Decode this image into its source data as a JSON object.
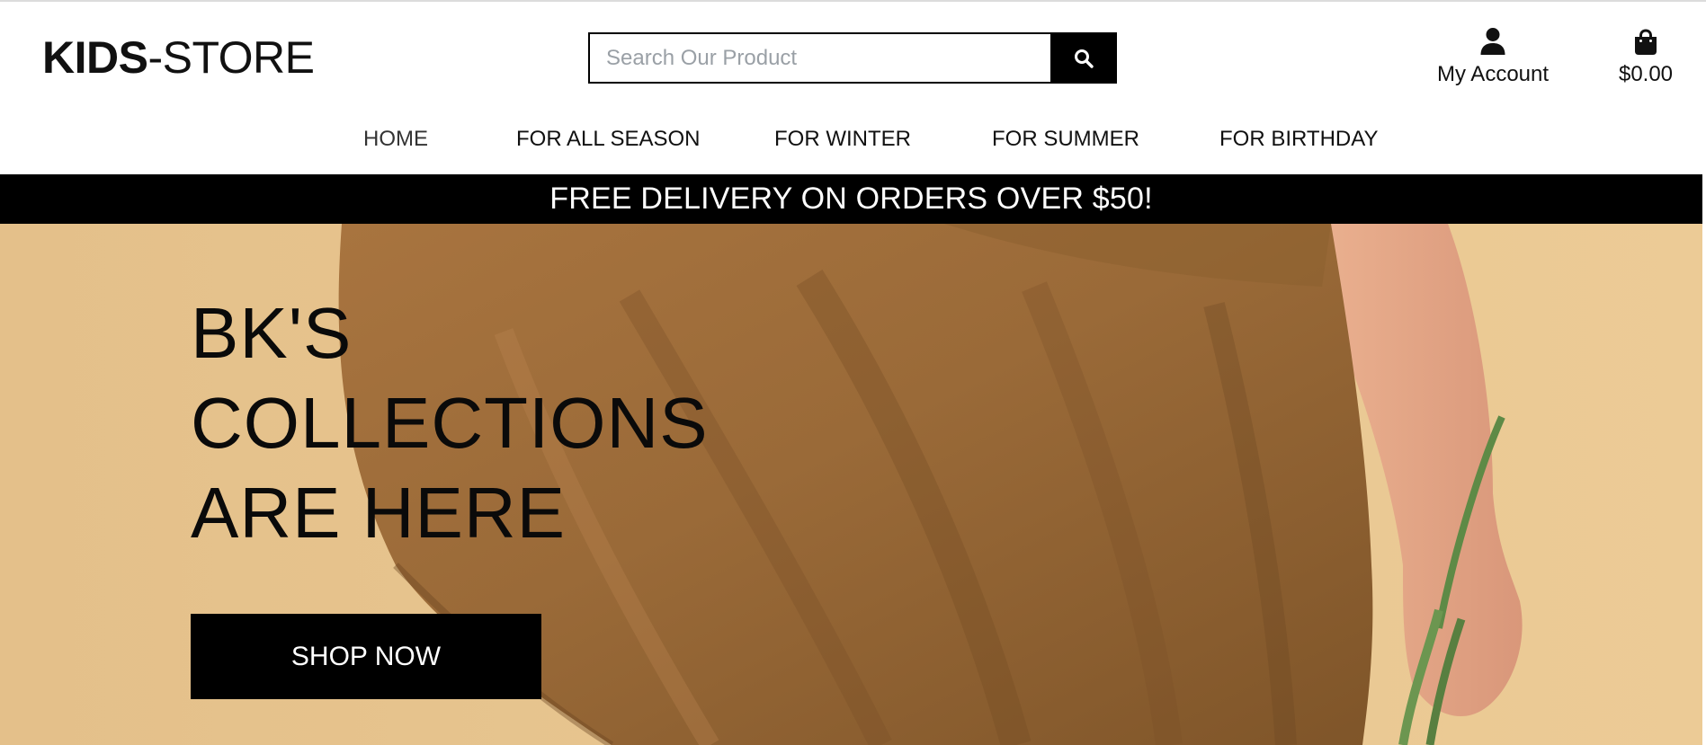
{
  "brand": {
    "logo_bold": "KIDS",
    "logo_rest": "-STORE"
  },
  "search": {
    "placeholder": "Search Our Product",
    "icon": "search-icon"
  },
  "account": {
    "label": "My Account",
    "icon": "user-icon"
  },
  "cart": {
    "total": "$0.00",
    "icon": "shopping-bag-icon"
  },
  "nav": {
    "items": [
      {
        "label": "HOME",
        "active": true
      },
      {
        "label": "FOR ALL SEASON"
      },
      {
        "label": "FOR WINTER"
      },
      {
        "label": "FOR SUMMER"
      },
      {
        "label": "FOR BIRTHDAY"
      }
    ]
  },
  "promo": {
    "text": "FREE DELIVERY ON ORDERS OVER $50!"
  },
  "hero": {
    "title_lines": [
      "BK'S",
      "COLLECTIONS",
      "ARE HERE"
    ],
    "cta_label": "SHOP NOW"
  },
  "colors": {
    "primary": "#000000",
    "background": "#ffffff",
    "hero_background": "#e6c28a",
    "dress": "#9c6b3a"
  }
}
